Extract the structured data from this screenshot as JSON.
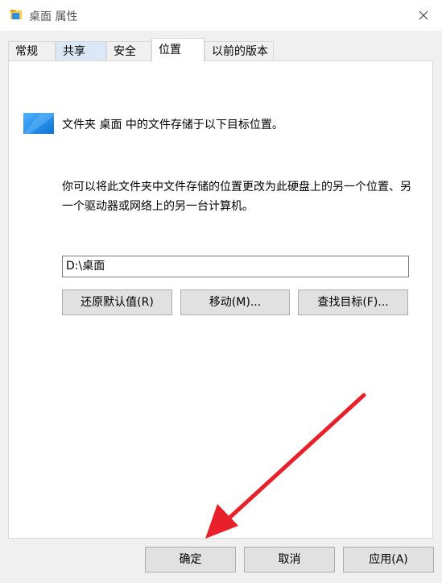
{
  "window": {
    "title": "桌面 属性",
    "icon": "folder-icon",
    "close_icon": "close-icon"
  },
  "tabs": [
    {
      "label": "常规"
    },
    {
      "label": "共享"
    },
    {
      "label": "安全"
    },
    {
      "label": "位置"
    },
    {
      "label": "以前的版本"
    }
  ],
  "location": {
    "folder_icon": "folder-icon",
    "summary": "文件夹 桌面 中的文件存储于以下目标位置。",
    "description": "你可以将此文件夹中文件存储的位置更改为此硬盘上的另一个位置、另一个驱动器或网络上的另一台计算机。",
    "path_value": "D:\\桌面",
    "restore_default_label": "还原默认值(R)",
    "move_label": "移动(M)...",
    "find_target_label": "查找目标(F)..."
  },
  "footer": {
    "ok_label": "确定",
    "cancel_label": "取消",
    "apply_label": "应用(A)"
  },
  "colors": {
    "accent": "#0078d7",
    "arrow": "#e8202a",
    "client_bg": "#f0f0f0",
    "button_bg": "#e1e1e1"
  }
}
